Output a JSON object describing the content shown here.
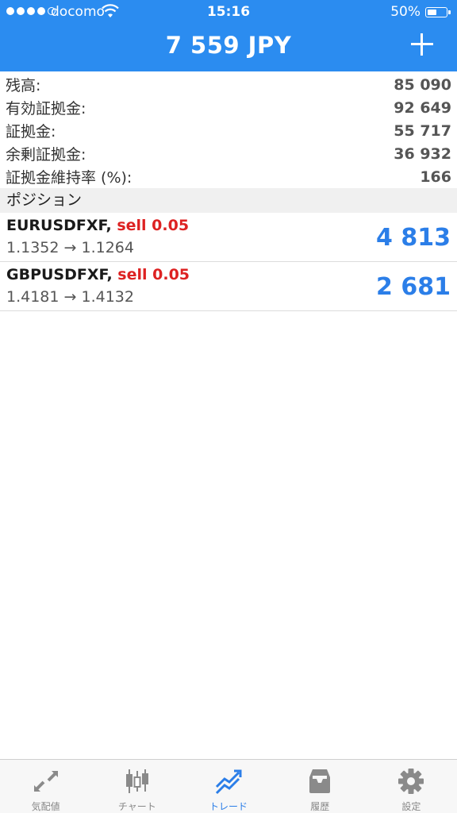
{
  "status": {
    "carrier": "docomo",
    "time": "15:16",
    "battery": "50%"
  },
  "nav": {
    "title": "7 559 JPY"
  },
  "summary": [
    {
      "label": "残高:",
      "value": "85 090"
    },
    {
      "label": "有効証拠金:",
      "value": "92 649"
    },
    {
      "label": "証拠金:",
      "value": "55 717"
    },
    {
      "label": "余剰証拠金:",
      "value": "36 932"
    },
    {
      "label": "証拠金維持率 (%):",
      "value": "166"
    }
  ],
  "section": {
    "positions_title": "ポジション"
  },
  "positions": [
    {
      "symbol": "EURUSDFXF,",
      "side": "sell 0.05",
      "prices": "1.1352 → 1.1264",
      "profit": "4 813"
    },
    {
      "symbol": "GBPUSDFXF,",
      "side": "sell 0.05",
      "prices": "1.4181 → 1.4132",
      "profit": "2 681"
    }
  ],
  "tabs": [
    {
      "label": "気配値",
      "icon": "quotes-icon"
    },
    {
      "label": "チャート",
      "icon": "chart-icon"
    },
    {
      "label": "トレード",
      "icon": "trade-icon",
      "active": true
    },
    {
      "label": "履歴",
      "icon": "history-icon"
    },
    {
      "label": "設定",
      "icon": "settings-icon"
    }
  ],
  "colors": {
    "accent": "#2b8cf0",
    "profit": "#2b7ee8",
    "sell": "#dd2222",
    "tab_inactive": "#888888"
  }
}
